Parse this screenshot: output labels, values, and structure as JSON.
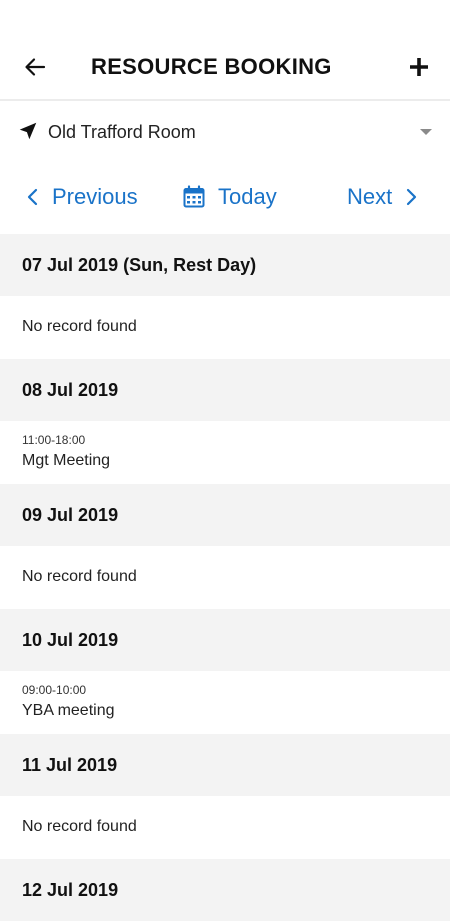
{
  "header": {
    "title": "RESOURCE BOOKING",
    "back_icon": "arrow-left-icon",
    "add_icon": "plus-icon"
  },
  "location": {
    "label": "Old Trafford Room",
    "icon": "navigation-arrow-icon"
  },
  "nav": {
    "previous_label": "Previous",
    "today_label": "Today",
    "next_label": "Next",
    "accent_color": "#1a73c8"
  },
  "days": [
    {
      "date": "07 Jul 2019 (Sun, Rest Day)",
      "empty_text": "No record found"
    },
    {
      "date": "08 Jul 2019",
      "booking": {
        "time": "11:00-18:00",
        "title": "Mgt Meeting"
      }
    },
    {
      "date": "09 Jul 2019",
      "empty_text": "No record found"
    },
    {
      "date": "10 Jul 2019",
      "booking": {
        "time": "09:00-10:00",
        "title": "YBA meeting"
      }
    },
    {
      "date": "11 Jul 2019",
      "empty_text": "No record found"
    },
    {
      "date": "12 Jul 2019"
    }
  ]
}
